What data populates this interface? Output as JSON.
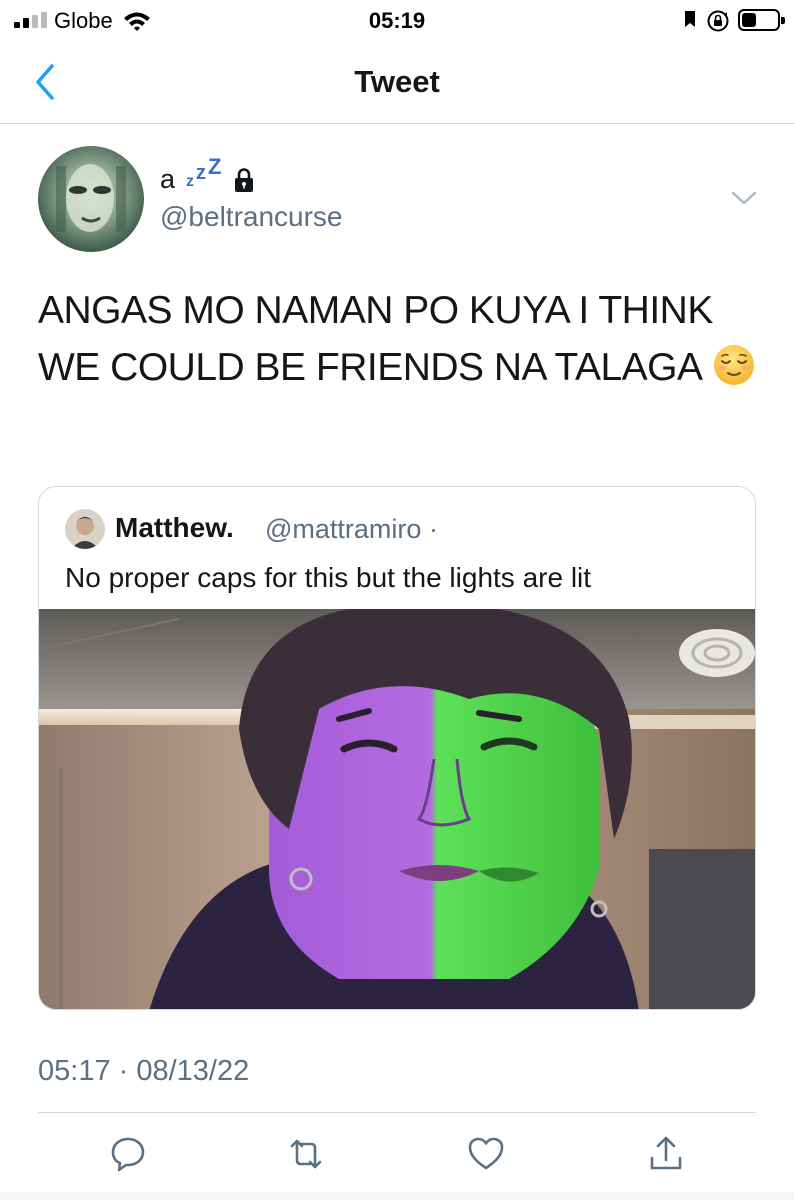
{
  "status_bar": {
    "carrier": "Globe",
    "time": "05:19",
    "signal_bars_filled": 2,
    "signal_bars_total": 4
  },
  "nav": {
    "title": "Tweet",
    "back_icon": "chevron-left-icon"
  },
  "tweet": {
    "display_name": "a",
    "display_name_suffix": "zzZ",
    "handle": "@beltrancurse",
    "text": "ANGAS MO NAMAN PO KUYA I THINK WE COULD BE FRIENDS NA TALAGA",
    "text_emoji": "relieved-face-emoji",
    "timestamp": "05:17 · 08/13/22"
  },
  "quoted_tweet": {
    "display_name": "Matthew.",
    "handle": "@mattramiro",
    "separator": "·",
    "text": "No proper caps for this but the lights are lit"
  },
  "actions": {
    "reply_icon": "reply-icon",
    "retweet_icon": "retweet-icon",
    "like_icon": "heart-icon",
    "share_icon": "share-icon"
  },
  "colors": {
    "link_blue": "#1da1f2",
    "secondary_text": "#5b7083",
    "primary_text": "#14171a",
    "border": "#cfd9de"
  }
}
